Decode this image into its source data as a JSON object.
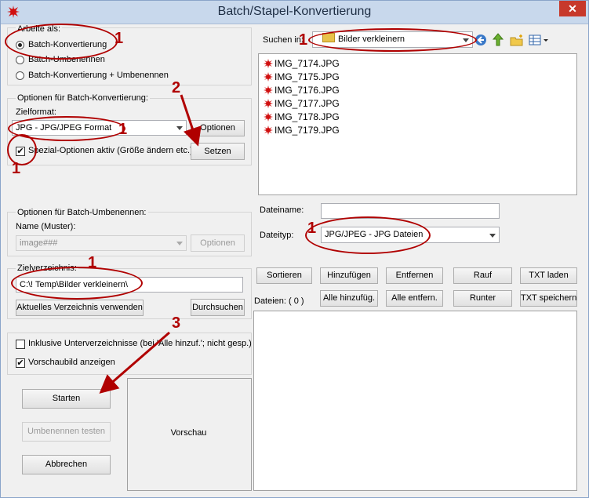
{
  "window": {
    "title": "Batch/Stapel-Konvertierung",
    "close_label": "✕"
  },
  "mode_group": {
    "label": "Arbeite als:",
    "options": [
      "Batch-Konvertierung",
      "Batch-Umbenennen",
      "Batch-Konvertierung + Umbenennen"
    ],
    "selected_index": 0
  },
  "conversion_group": {
    "label": "Optionen für Batch-Konvertierung:",
    "format_label": "Zielformat:",
    "format_value": "JPG - JPG/JPEG Format",
    "options_button": "Optionen",
    "special_checkbox": "Spezial-Optionen aktiv (Größe ändern etc.)",
    "special_checked": true,
    "set_button": "Setzen"
  },
  "rename_group": {
    "label": "Optionen für Batch-Umbenennen:",
    "name_label": "Name (Muster):",
    "name_value": "image###",
    "options_button": "Optionen"
  },
  "target_group": {
    "label": "Zielverzeichnis:",
    "path_value": "C:\\! Temp\\Bilder verkleinern\\",
    "current_dir_button": "Aktuelles Verzeichnis verwenden",
    "browse_button": "Durchsuchen"
  },
  "extra_options": {
    "subdirs": "Inklusive Unterverzeichnisse (bei 'Alle hinzuf.'; nicht gesp.)",
    "subdirs_checked": false,
    "preview": "Vorschaubild anzeigen",
    "preview_checked": true
  },
  "actions": {
    "start": "Starten",
    "test_rename": "Umbenennen testen",
    "cancel": "Abbrechen"
  },
  "preview_label": "Vorschau",
  "browser": {
    "search_in_label": "Suchen in:",
    "folder_value": "Bilder verkleinern",
    "files": [
      "IMG_7174.JPG",
      "IMG_7175.JPG",
      "IMG_7176.JPG",
      "IMG_7177.JPG",
      "IMG_7178.JPG",
      "IMG_7179.JPG"
    ],
    "filename_label": "Dateiname:",
    "filename_value": "",
    "filetype_label": "Dateityp:",
    "filetype_value": "JPG/JPEG - JPG Dateien"
  },
  "list_buttons": {
    "sort": "Sortieren",
    "add": "Hinzufügen",
    "remove": "Entfernen",
    "up": "Rauf",
    "load_txt": "TXT laden",
    "add_all": "Alle hinzufüg.",
    "remove_all": "Alle entfern.",
    "down": "Runter",
    "save_txt": "TXT speichern"
  },
  "files_count_label": "Dateien:  ( 0 )",
  "annotations": [
    "1",
    "1",
    "1",
    "1",
    "1",
    "1",
    "1",
    "2",
    "3"
  ],
  "colors": {
    "annotation": "#b00000",
    "titlebar": "#c8d8ec",
    "close": "#c7392b"
  }
}
